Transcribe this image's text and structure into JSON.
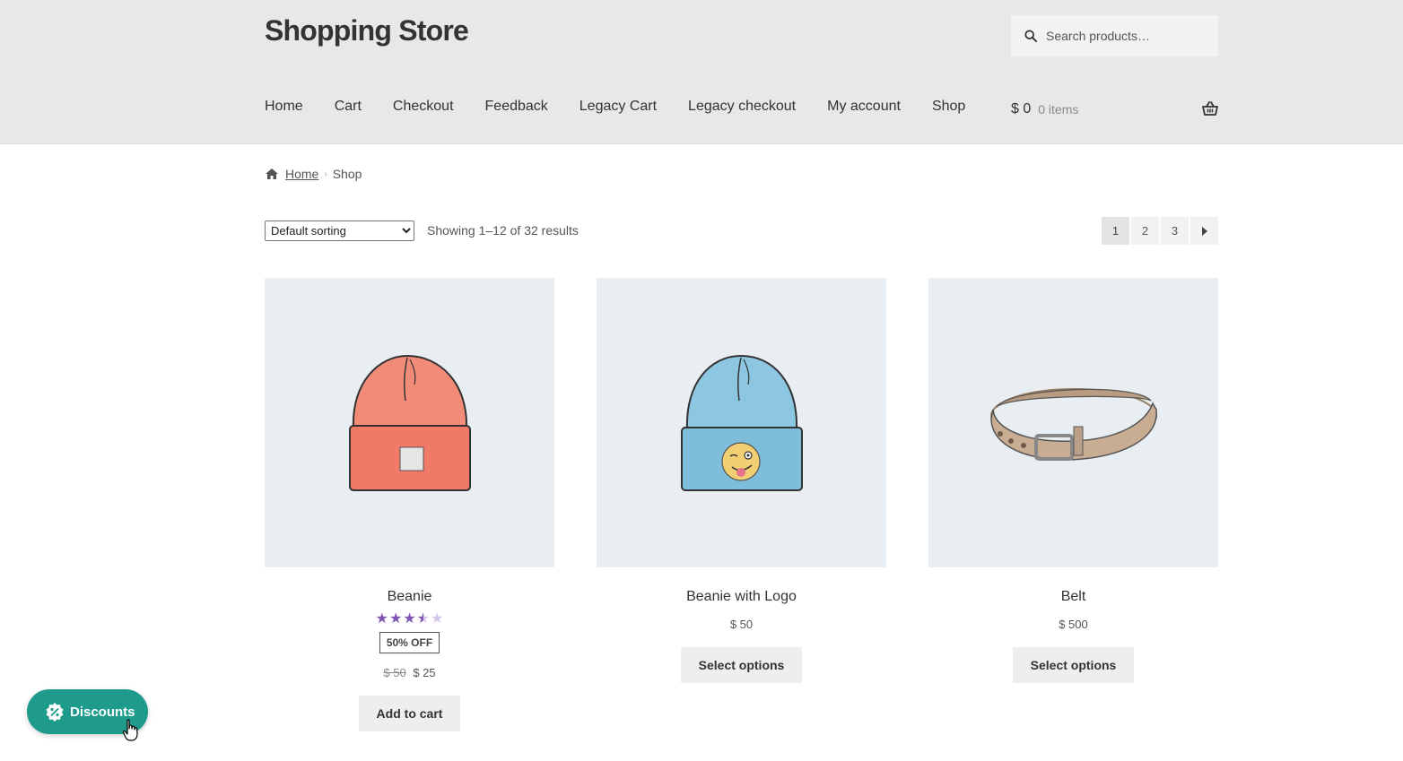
{
  "site": {
    "title": "Shopping Store"
  },
  "search": {
    "placeholder": "Search products…"
  },
  "nav": {
    "items": [
      "Home",
      "Cart",
      "Checkout",
      "Feedback",
      "Legacy Cart",
      "Legacy checkout",
      "My account",
      "Shop"
    ]
  },
  "cart": {
    "amount": "$ 0",
    "count": "0 items"
  },
  "breadcrumb": {
    "home": "Home",
    "current": "Shop"
  },
  "toolbar": {
    "sort_selected": "Default sorting",
    "result_count": "Showing 1–12 of 32 results"
  },
  "pagination": {
    "pages": [
      "1",
      "2",
      "3"
    ],
    "current": "1"
  },
  "products": [
    {
      "name": "Beanie",
      "rating": 3.5,
      "rating_max": 5,
      "badge": "50% OFF",
      "old_price": "$ 50",
      "price": "$ 25",
      "button": "Add to cart",
      "image_icon": "orange-beanie-icon"
    },
    {
      "name": "Beanie with Logo",
      "price": "$ 50",
      "button": "Select options",
      "image_icon": "blue-beanie-logo-icon"
    },
    {
      "name": "Belt",
      "price": "$ 500",
      "button": "Select options",
      "image_icon": "belt-icon"
    }
  ],
  "discounts": {
    "label": "Discounts"
  },
  "colors": {
    "header_bg": "#e8e8e8",
    "accent_purple": "#7f54b3",
    "discount_green": "#1e9b8a",
    "product_bg": "#e9eef2"
  }
}
